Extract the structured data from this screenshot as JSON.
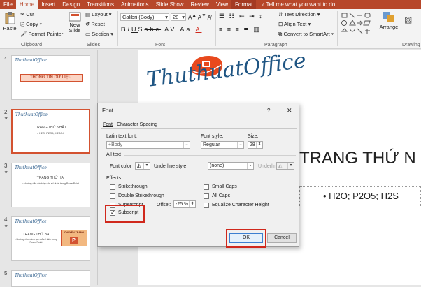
{
  "tabs": [
    "File",
    "Home",
    "Insert",
    "Design",
    "Transitions",
    "Animations",
    "Slide Show",
    "Review",
    "View",
    "Format"
  ],
  "tellme": "Tell me what you want to do...",
  "ribbon": {
    "clipboard": {
      "paste": "Paste",
      "cut": "Cut",
      "copy": "Copy",
      "format_painter": "Format Painter",
      "label": "Clipboard"
    },
    "slides": {
      "new_slide": "New Slide",
      "layout": "Layout",
      "reset": "Reset",
      "section": "Section",
      "label": "Slides"
    },
    "font": {
      "name": "Calibri (Body)",
      "size": "28",
      "label": "Font"
    },
    "paragraph": {
      "text_direction": "Text Direction",
      "align_text": "Align Text",
      "convert": "Convert to SmartArt",
      "label": "Paragraph"
    },
    "drawing": {
      "arrange": "Arrange",
      "label": "Drawing"
    }
  },
  "slides": [
    {
      "num": "1",
      "logo": "ThuthuatOffice",
      "title": "THÔNG TIN DỮ LIỆU",
      "sub": ""
    },
    {
      "num": "2",
      "logo": "ThuthuatOffice",
      "title": "TRANG THỨ NHẤT",
      "sub": "• H2O; P2O5; H2SO4"
    },
    {
      "num": "3",
      "logo": "ThuthuatOffice",
      "title": "TRANG THỨ HAI",
      "sub": "• Hướng dẫn cách tạo chỉ số dưới trong PowerPoint"
    },
    {
      "num": "4",
      "logo": "ThuthuatOffice",
      "title": "TRANG THỨ BA",
      "sub": "• Hướng dẫn cách tạo chỉ số trên trong PowerPoint",
      "badge": "CHUYỂN TRANG"
    },
    {
      "num": "5",
      "logo": "ThuthuatOffice",
      "title": "",
      "sub": ""
    }
  ],
  "slide": {
    "logo": "ThuthuatOffice",
    "title": "TRANG THỨ N",
    "bullet": "• H2O; P2O5; H2S"
  },
  "dialog": {
    "title": "Font",
    "help": "?",
    "close": "✕",
    "tabs": [
      "Font",
      "Character Spacing"
    ],
    "latin_label": "Latin text font:",
    "latin_value": "+Body",
    "style_label": "Font style:",
    "style_value": "Regular",
    "size_label": "Size:",
    "size_value": "28",
    "alltext": "All text",
    "font_color": "Font color",
    "underline_style_label": "Underline style",
    "underline_style_value": "(none)",
    "underline_color": "Underline color",
    "effects": "Effects",
    "strikethrough": "Strikethrough",
    "double_strike": "Double Strikethrough",
    "superscript": "Superscript",
    "subscript": "Subscript",
    "offset_label": "Offset:",
    "offset_value": "-25 %",
    "small_caps": "Small Caps",
    "all_caps": "All Caps",
    "equalize": "Equalize Character Height",
    "ok": "OK",
    "cancel": "Cancel"
  },
  "colors": {
    "accent": "#b7472a",
    "highlight": "#d0281c"
  }
}
